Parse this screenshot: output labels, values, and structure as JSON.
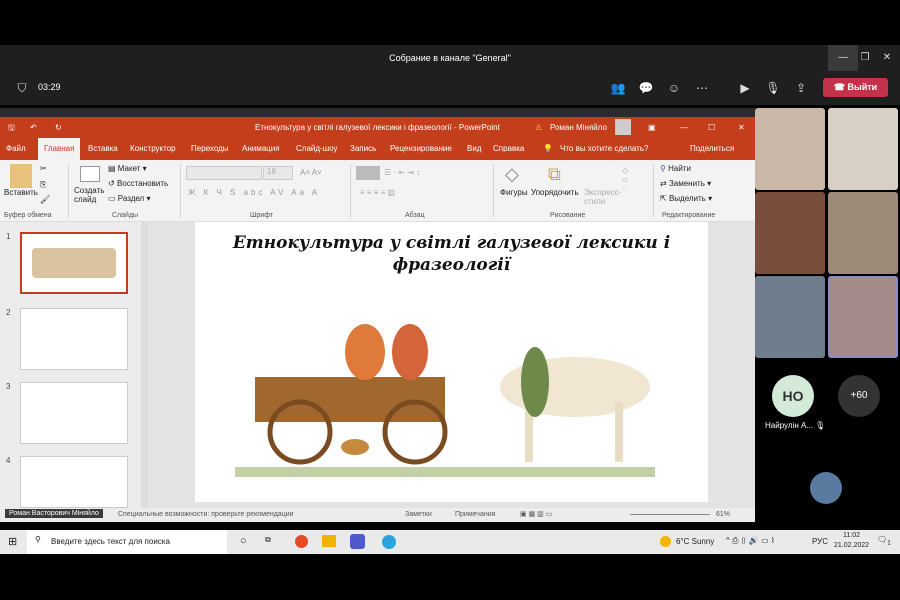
{
  "teams": {
    "window_title": "Собрание в канале \"General\"",
    "timer": "03:29",
    "leave_label": "Выйти",
    "leave_color": "#c4314b",
    "participants": [
      {
        "name": "",
        "bg": "#c9b7a8"
      },
      {
        "name": "",
        "bg": "#d8d0c4"
      },
      {
        "name": "",
        "bg": "#7a4e3c"
      },
      {
        "name": "",
        "bg": "#9d8a78"
      },
      {
        "name": "",
        "bg": "#6f7d8c"
      },
      {
        "name": "",
        "bg": "#a58a8a"
      }
    ],
    "avatar_initials": "НО",
    "avatar_name": "Найрулін А...",
    "more_count": "+60"
  },
  "powerpoint": {
    "title": "Етнокультура у світлі галузевої лексики і фразеології - PowerPoint",
    "user": "Роман Міняйло",
    "accent": "#c43e1c",
    "tabs": [
      "Файл",
      "Главная",
      "Вставка",
      "Конструктор",
      "Переходы",
      "Анимация",
      "Слайд-шоу",
      "Запись",
      "Рецензирование",
      "Вид",
      "Справка"
    ],
    "tell_me": "Что вы хотите сделать?",
    "share": "Поделиться",
    "ribbon": {
      "paste": "Вставить",
      "clipboard": "Буфер обмена",
      "new_slide": "Создать слайд",
      "layout": "Макет",
      "reset": "Восстановить",
      "section": "Раздел",
      "slides": "Слайды",
      "font_size": "18",
      "font_buttons": "Ж К Ч S abc AV Aa A",
      "font": "Шрифт",
      "paragraph": "Абзац",
      "shapes": "Фигуры",
      "arrange": "Упорядочить",
      "quick_styles": "Экспресс-стили",
      "drawing": "Рисование",
      "find": "Найти",
      "replace": "Заменить",
      "select": "Выделить",
      "editing": "Редактирование"
    },
    "slide_numbers": [
      "1",
      "2",
      "3",
      "4"
    ],
    "slide_title": "Етнокультура у світлі галузевої лексики і фразеології",
    "status": {
      "presenter": "Роман Васторович Міняйло",
      "accessibility": "Специальные возможности: проверьте рекомендации",
      "notes": "Заметки",
      "comments": "Примечания",
      "zoom": "61%"
    }
  },
  "taskbar": {
    "search_placeholder": "Введите здесь текст для поиска",
    "weather": "6°C  Sunny",
    "lang": "РУС",
    "time": "11:02",
    "date": "21.02.2022",
    "notifications": "1"
  }
}
